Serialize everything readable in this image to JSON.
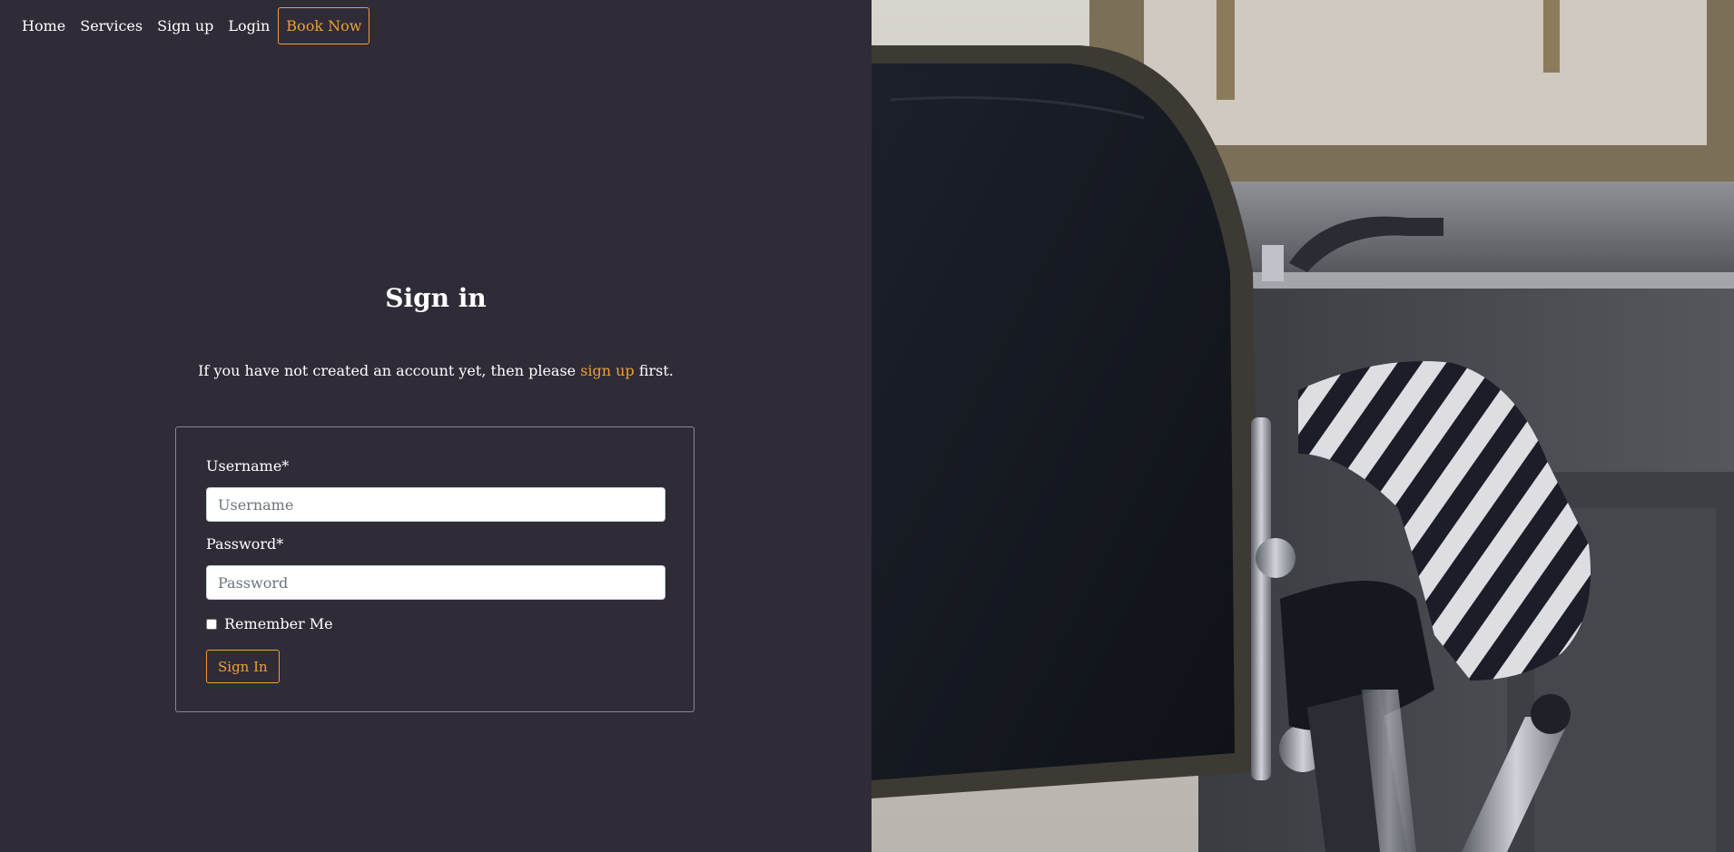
{
  "nav": {
    "items": [
      "Home",
      "Services",
      "Sign up",
      "Login"
    ],
    "book_now": "Book Now"
  },
  "signin": {
    "title": "Sign in",
    "intro_before": "If you have not created an account yet, then please ",
    "intro_link": "sign up",
    "intro_after": " first.",
    "username_label": "Username*",
    "username_placeholder": "Username",
    "password_label": "Password*",
    "password_placeholder": "Password",
    "remember_label": "Remember Me",
    "submit_label": "Sign In"
  },
  "colors": {
    "accent": "#f0a030",
    "background": "#2f2c38"
  },
  "hero": {
    "icon": "barber-chair-photo"
  }
}
